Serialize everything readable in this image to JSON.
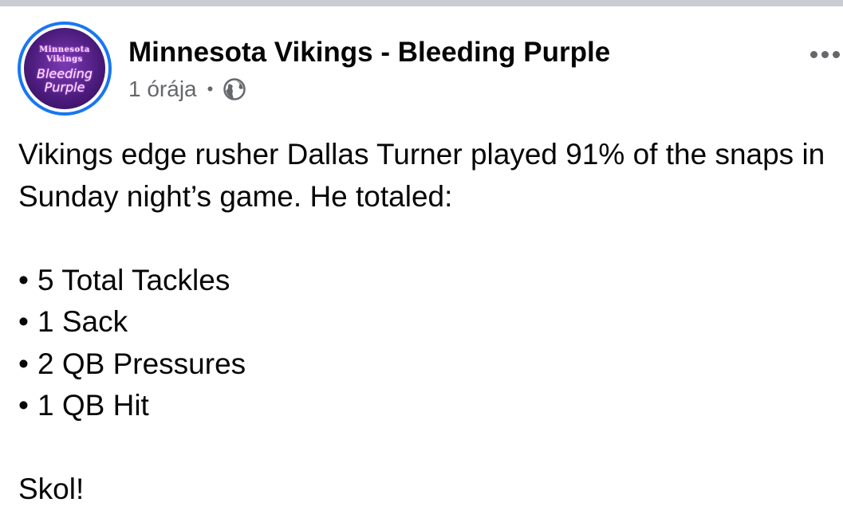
{
  "post": {
    "page_name": "Minnesota Vikings - Bleeding Purple",
    "timestamp": "1 órája",
    "separator": "•",
    "avatar": {
      "line1": "Minnesota",
      "line2": "Vikings",
      "line3": "Bleeding",
      "line4": "Purple"
    },
    "icons": {
      "audience": "globe-icon",
      "more": "more-options-icon"
    },
    "text": {
      "intro": "Vikings edge rusher Dallas Turner played 91% of the snaps in Sunday night’s game. He totaled:",
      "bullet_mark": "•",
      "bullets": [
        "5 Total Tackles",
        "1 Sack",
        "2 QB Pressures",
        "1 QB Hit"
      ],
      "closing": "Skol!"
    }
  },
  "colors": {
    "avatar_ring": "#1877f2",
    "meta_gray": "#65676b",
    "text": "#050505",
    "logo_purple": "#4a1a7a"
  }
}
